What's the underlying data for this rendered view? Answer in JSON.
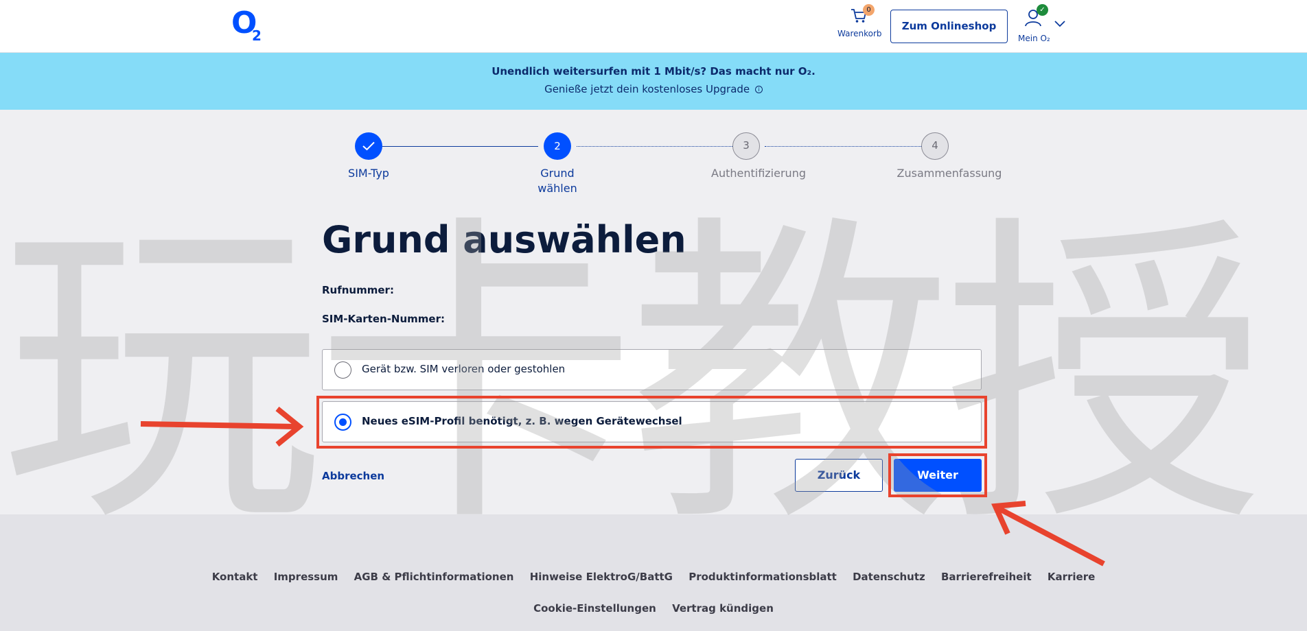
{
  "header": {
    "logo_o": "O",
    "logo_two": "2",
    "cart_label": "Warenkorb",
    "cart_count": "0",
    "shop_button": "Zum Onlineshop",
    "account_label": "Mein O₂",
    "account_check": "✓"
  },
  "promo": {
    "line1": "Unendlich weitersurfen mit 1 Mbit/s? Das macht nur O₂.",
    "line2": "Genieße jetzt dein kostenloses Upgrade",
    "info_glyph": "i"
  },
  "stepper": {
    "steps": [
      {
        "number": "✓",
        "label": "SIM-Typ",
        "state": "done"
      },
      {
        "number": "2",
        "label_l1": "Grund",
        "label_l2": "wählen",
        "state": "current"
      },
      {
        "number": "3",
        "label": "Authentifizierung",
        "state": "upcoming"
      },
      {
        "number": "4",
        "label": "Zusammenfassung",
        "state": "upcoming"
      }
    ]
  },
  "main": {
    "title": "Grund auswählen",
    "phone_label": "Rufnummer:",
    "sim_label": "SIM-Karten-Nummer:",
    "options": [
      {
        "label": "Gerät bzw. SIM verloren oder gestohlen",
        "selected": false
      },
      {
        "label": "Neues eSIM-Profil benötigt, z. B. wegen Gerätewechsel",
        "selected": true
      }
    ],
    "cancel": "Abbrechen",
    "back": "Zurück",
    "next": "Weiter"
  },
  "watermark": "玩卡教授",
  "annotation_color": "#e8432e",
  "brand_color": "#0050ff",
  "footer": {
    "row1": [
      "Kontakt",
      "Impressum",
      "AGB & Pflichtinformationen",
      "Hinweise ElektroG/BattG",
      "Produktinformationsblatt",
      "Datenschutz",
      "Barrierefreiheit",
      "Karriere"
    ],
    "row2": [
      "Cookie-Einstellungen",
      "Vertrag kündigen"
    ]
  }
}
